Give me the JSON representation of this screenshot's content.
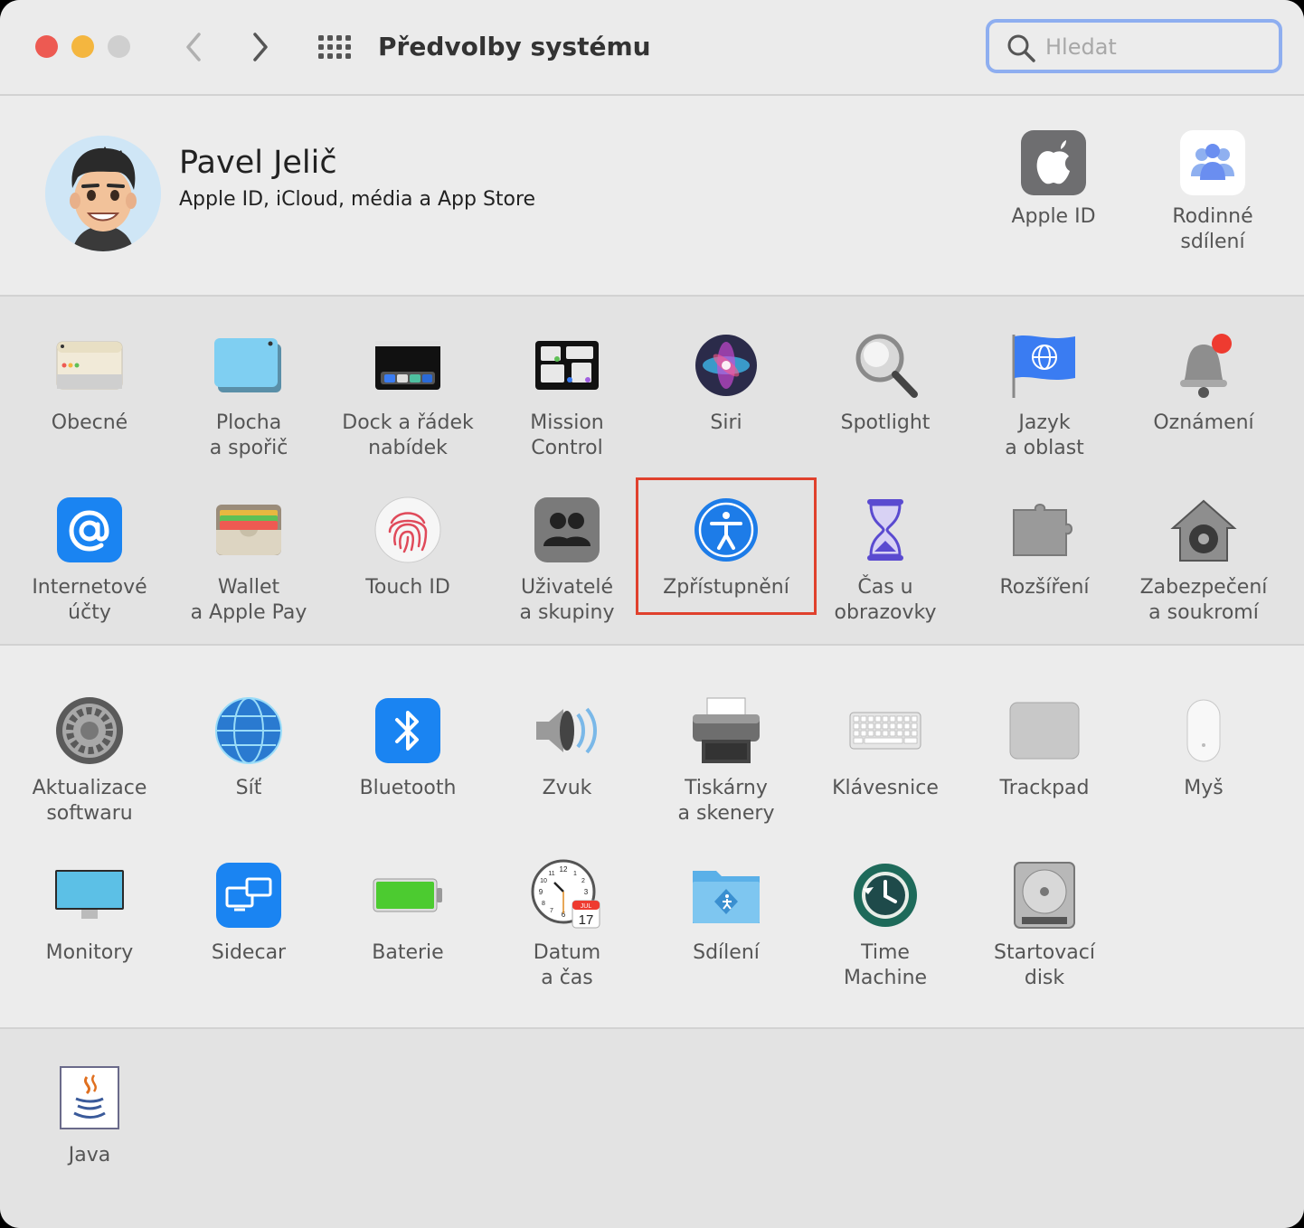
{
  "window": {
    "title": "Předvolby systému",
    "search_placeholder": "Hledat"
  },
  "account": {
    "name": "Pavel Jelič",
    "subtitle": "Apple ID, iCloud, média a App Store",
    "apple_id_label": "Apple ID",
    "family_label": "Rodinné\nsdílení"
  },
  "panes": {
    "general": "Obecné",
    "desktop": "Plocha\na spořič",
    "dock": "Dock a řádek\nnabídek",
    "mission": "Mission\nControl",
    "siri": "Siri",
    "spotlight": "Spotlight",
    "language": "Jazyk\na oblast",
    "notifications": "Oznámení",
    "internet": "Internetové\núčty",
    "wallet": "Wallet\na Apple Pay",
    "touchid": "Touch ID",
    "users": "Uživatelé\na skupiny",
    "accessibility": "Zpřístupnění",
    "screentime": "Čas u obrazovky",
    "extensions": "Rozšíření",
    "security": "Zabezpečení\na soukromí",
    "software": "Aktualizace\nsoftwaru",
    "network": "Síť",
    "bluetooth": "Bluetooth",
    "sound": "Zvuk",
    "printers": "Tiskárny\na skenery",
    "keyboard": "Klávesnice",
    "trackpad": "Trackpad",
    "mouse": "Myš",
    "displays": "Monitory",
    "sidecar": "Sidecar",
    "battery": "Baterie",
    "datetime": "Datum\na čas",
    "sharing": "Sdílení",
    "timemachine": "Time\nMachine",
    "startup": "Startovací\ndisk",
    "java": "Java"
  },
  "clock": {
    "month": "JUL",
    "day": "17",
    "numerals": [
      "12",
      "1",
      "2",
      "3",
      "4",
      "5",
      "6",
      "7",
      "8",
      "9",
      "10",
      "11"
    ]
  },
  "colors": {
    "highlight": "#e0412d",
    "close": "#ed5a52",
    "minimize": "#f4b63f",
    "zoom_inactive": "#cfcfcf",
    "search_focus": "#8eaef0"
  }
}
